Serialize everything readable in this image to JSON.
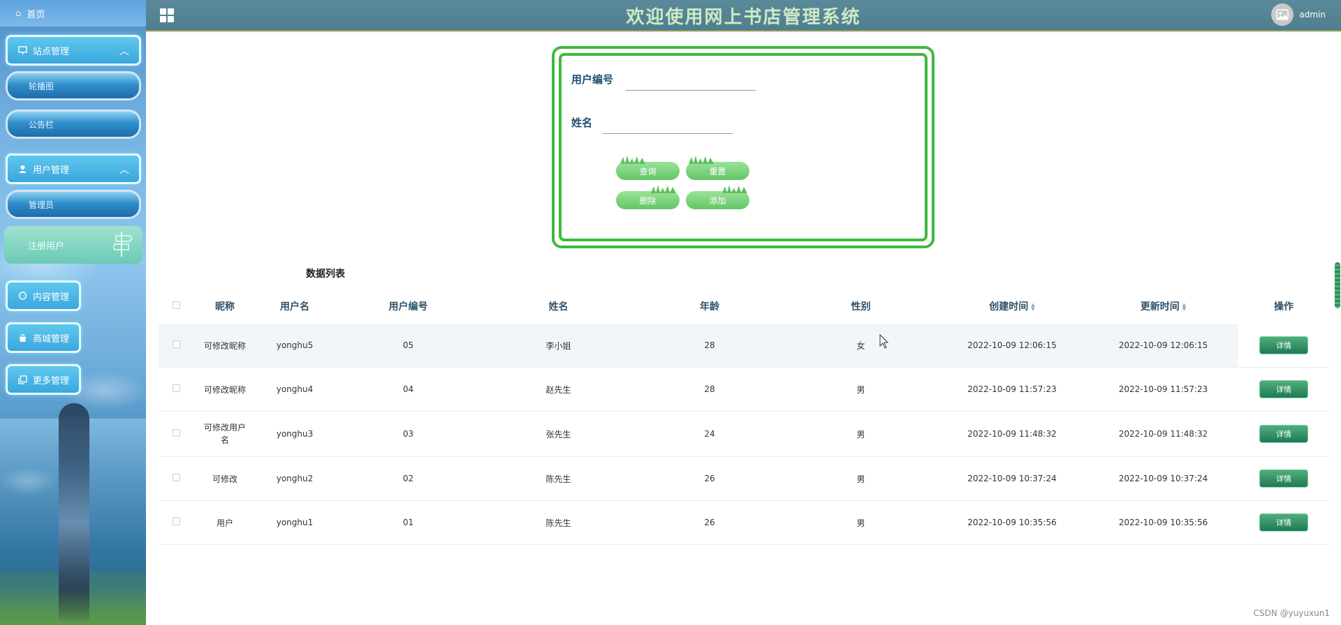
{
  "header": {
    "title": "欢迎使用网上书店管理系统",
    "username": "admin"
  },
  "sidebar": {
    "home": "首页",
    "groups": [
      {
        "label": "站点管理",
        "icon": "monitor-icon",
        "expanded": true,
        "items": [
          {
            "label": "轮播图"
          },
          {
            "label": "公告栏"
          }
        ]
      },
      {
        "label": "用户管理",
        "icon": "user-icon",
        "expanded": true,
        "items": [
          {
            "label": "管理员"
          },
          {
            "label": "注册用户",
            "active": true
          }
        ]
      },
      {
        "label": "内容管理",
        "icon": "chat-icon"
      },
      {
        "label": "商城管理",
        "icon": "bag-icon"
      },
      {
        "label": "更多管理",
        "icon": "copy-icon"
      }
    ]
  },
  "search": {
    "user_no_label": "用户编号",
    "user_no_value": "",
    "name_label": "姓名",
    "name_value": "",
    "query_btn": "查询",
    "reset_btn": "重置",
    "delete_btn": "删除",
    "add_btn": "添加"
  },
  "table": {
    "title": "数据列表",
    "columns": [
      "昵称",
      "用户名",
      "用户编号",
      "姓名",
      "年龄",
      "性别",
      "创建时间",
      "更新时间",
      "操作"
    ],
    "rows": [
      {
        "nickname": "可修改昵称",
        "username": "yonghu5",
        "user_no": "05",
        "name": "李小姐",
        "age": "28",
        "gender": "女",
        "created": "2022-10-09 12:06:15",
        "updated": "2022-10-09 12:06:15",
        "action": "详情"
      },
      {
        "nickname": "可修改昵称",
        "username": "yonghu4",
        "user_no": "04",
        "name": "赵先生",
        "age": "28",
        "gender": "男",
        "created": "2022-10-09 11:57:23",
        "updated": "2022-10-09 11:57:23",
        "action": "详情"
      },
      {
        "nickname": "可修改用户名",
        "username": "yonghu3",
        "user_no": "03",
        "name": "张先生",
        "age": "24",
        "gender": "男",
        "created": "2022-10-09 11:48:32",
        "updated": "2022-10-09 11:48:32",
        "action": "详情"
      },
      {
        "nickname": "可修改",
        "username": "yonghu2",
        "user_no": "02",
        "name": "陈先生",
        "age": "26",
        "gender": "男",
        "created": "2022-10-09 10:37:24",
        "updated": "2022-10-09 10:37:24",
        "action": "详情"
      },
      {
        "nickname": "用户",
        "username": "yonghu1",
        "user_no": "01",
        "name": "陈先生",
        "age": "26",
        "gender": "男",
        "created": "2022-10-09 10:35:56",
        "updated": "2022-10-09 10:35:56",
        "action": "详情"
      }
    ]
  },
  "watermark": "CSDN @yuyuxun1",
  "colors": {
    "header_bg": "#5a8a9a",
    "title_color": "#cfe9c4",
    "search_border": "#3fb93f",
    "detail_button": "#1f7a55"
  }
}
